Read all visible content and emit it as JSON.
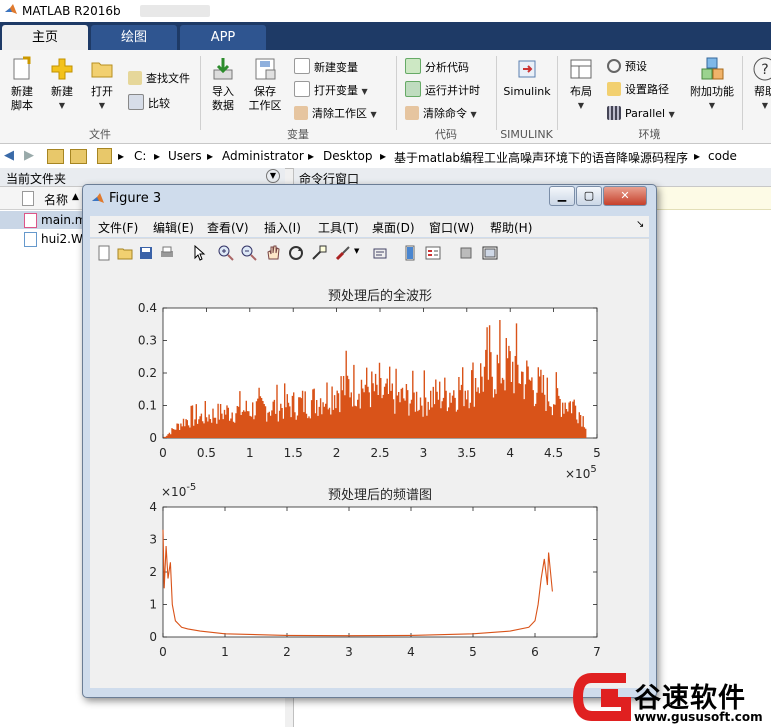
{
  "app": {
    "title": "MATLAB R2016b",
    "icon": "matlab-logo-icon"
  },
  "ribbon": {
    "tabs": [
      "主页",
      "绘图",
      "APP"
    ],
    "active_tab": "主页",
    "buttons": {
      "new_script": "新建\n脚本",
      "new": "新建",
      "open": "打开",
      "find_files": "查找文件",
      "compare": "比较",
      "import": "导入\n数据",
      "save_ws": "保存\n工作区",
      "new_var": "新建变量",
      "open_var": "打开变量",
      "clear_ws": "清除工作区",
      "analyze": "分析代码",
      "run_time": "运行并计时",
      "clear_cmd": "清除命令",
      "simulink": "Simulink",
      "layout": "布局",
      "prefs": "预设",
      "set_path": "设置路径",
      "parallel": "Parallel",
      "addons": "附加功能",
      "help": "帮助"
    },
    "groups": [
      "文件",
      "变量",
      "代码",
      "SIMULINK",
      "环境"
    ]
  },
  "address": {
    "crumbs": [
      "C:",
      "Users",
      "Administrator",
      "Desktop",
      "基于matlab编程工业高噪声环境下的语音降噪源码程序",
      "code"
    ]
  },
  "current_folder": {
    "title": "当前文件夹",
    "column_name": "名称",
    "sort": "▲",
    "files": [
      "main.m",
      "hui2.W"
    ]
  },
  "command_window": {
    "title": "命令行窗口"
  },
  "figure": {
    "title": "Figure 3",
    "menu": [
      "文件(F)",
      "编辑(E)",
      "查看(V)",
      "插入(I)",
      "工具(T)",
      "桌面(D)",
      "窗口(W)",
      "帮助(H)"
    ],
    "toolbar_icons": [
      "new-figure-icon",
      "open-file-icon",
      "save-icon",
      "print-icon",
      "pointer-icon",
      "zoom-in-icon",
      "zoom-out-icon",
      "pan-hand-icon",
      "rotate-icon",
      "data-cursor-icon",
      "brush-icon",
      "link-icon",
      "colorbar-icon",
      "legend-icon",
      "hide-tools-icon",
      "dock-icon"
    ]
  },
  "chart_data": [
    {
      "type": "area",
      "title": "预处理后的全波形",
      "xlabel": "",
      "ylabel": "",
      "xlim": [
        0,
        500000
      ],
      "ylim": [
        0,
        0.4
      ],
      "xticks": [
        "0",
        "0.5",
        "1",
        "1.5",
        "2",
        "2.5",
        "3",
        "3.5",
        "4",
        "4.5",
        "5"
      ],
      "yticks": [
        "0",
        "0.1",
        "0.2",
        "0.3",
        "0.4"
      ],
      "x_multiplier": "× 10^5",
      "x_multiplier_base": "×10",
      "x_multiplier_exp": "5",
      "color": "#d95319",
      "series": [
        {
          "x": [
            0,
            25000,
            50000,
            75000,
            100000,
            125000,
            150000,
            175000,
            200000,
            225000,
            250000,
            275000,
            300000,
            325000,
            350000,
            375000,
            400000,
            425000,
            450000,
            475000,
            487000
          ],
          "values": [
            0.0,
            0.08,
            0.1,
            0.12,
            0.13,
            0.14,
            0.15,
            0.17,
            0.22,
            0.25,
            0.2,
            0.18,
            0.18,
            0.2,
            0.24,
            0.3,
            0.33,
            0.25,
            0.18,
            0.15,
            0.07
          ]
        }
      ]
    },
    {
      "type": "line",
      "title": "预处理后的频谱图",
      "xlabel": "",
      "ylabel": "",
      "xlim": [
        0,
        7
      ],
      "ylim": [
        0,
        4e-05
      ],
      "xticks": [
        "0",
        "1",
        "2",
        "3",
        "4",
        "5",
        "6",
        "7"
      ],
      "yticks": [
        "0",
        "1",
        "2",
        "3",
        "4"
      ],
      "y_multiplier": "× 10^-5",
      "y_multiplier_base": "×10",
      "y_multiplier_exp": "-5",
      "color": "#d95319",
      "series": [
        {
          "x": [
            0.0,
            0.02,
            0.05,
            0.08,
            0.12,
            0.15,
            0.2,
            0.25,
            0.3,
            0.4,
            0.6,
            1.0,
            2.0,
            3.0,
            4.0,
            5.0,
            5.6,
            5.9,
            6.0,
            6.05,
            6.1,
            6.15,
            6.2,
            6.22,
            6.25,
            6.28
          ],
          "values": [
            3.3e-05,
            1.5e-05,
            2.8e-05,
            1.8e-05,
            2.3e-05,
            1e-05,
            5e-06,
            4e-06,
            3e-06,
            2.5e-06,
            1.8e-06,
            1e-06,
            5e-07,
            4e-07,
            5e-07,
            1e-06,
            1.8e-06,
            3e-06,
            5e-06,
            1e-05,
            1.8e-05,
            2.4e-05,
            1.6e-05,
            2.6e-05,
            2e-05,
            1.4e-05
          ]
        }
      ]
    }
  ],
  "watermark": {
    "brand": "谷速软件",
    "url": "www.gususoft.com",
    "brand_color": "#e02020"
  }
}
